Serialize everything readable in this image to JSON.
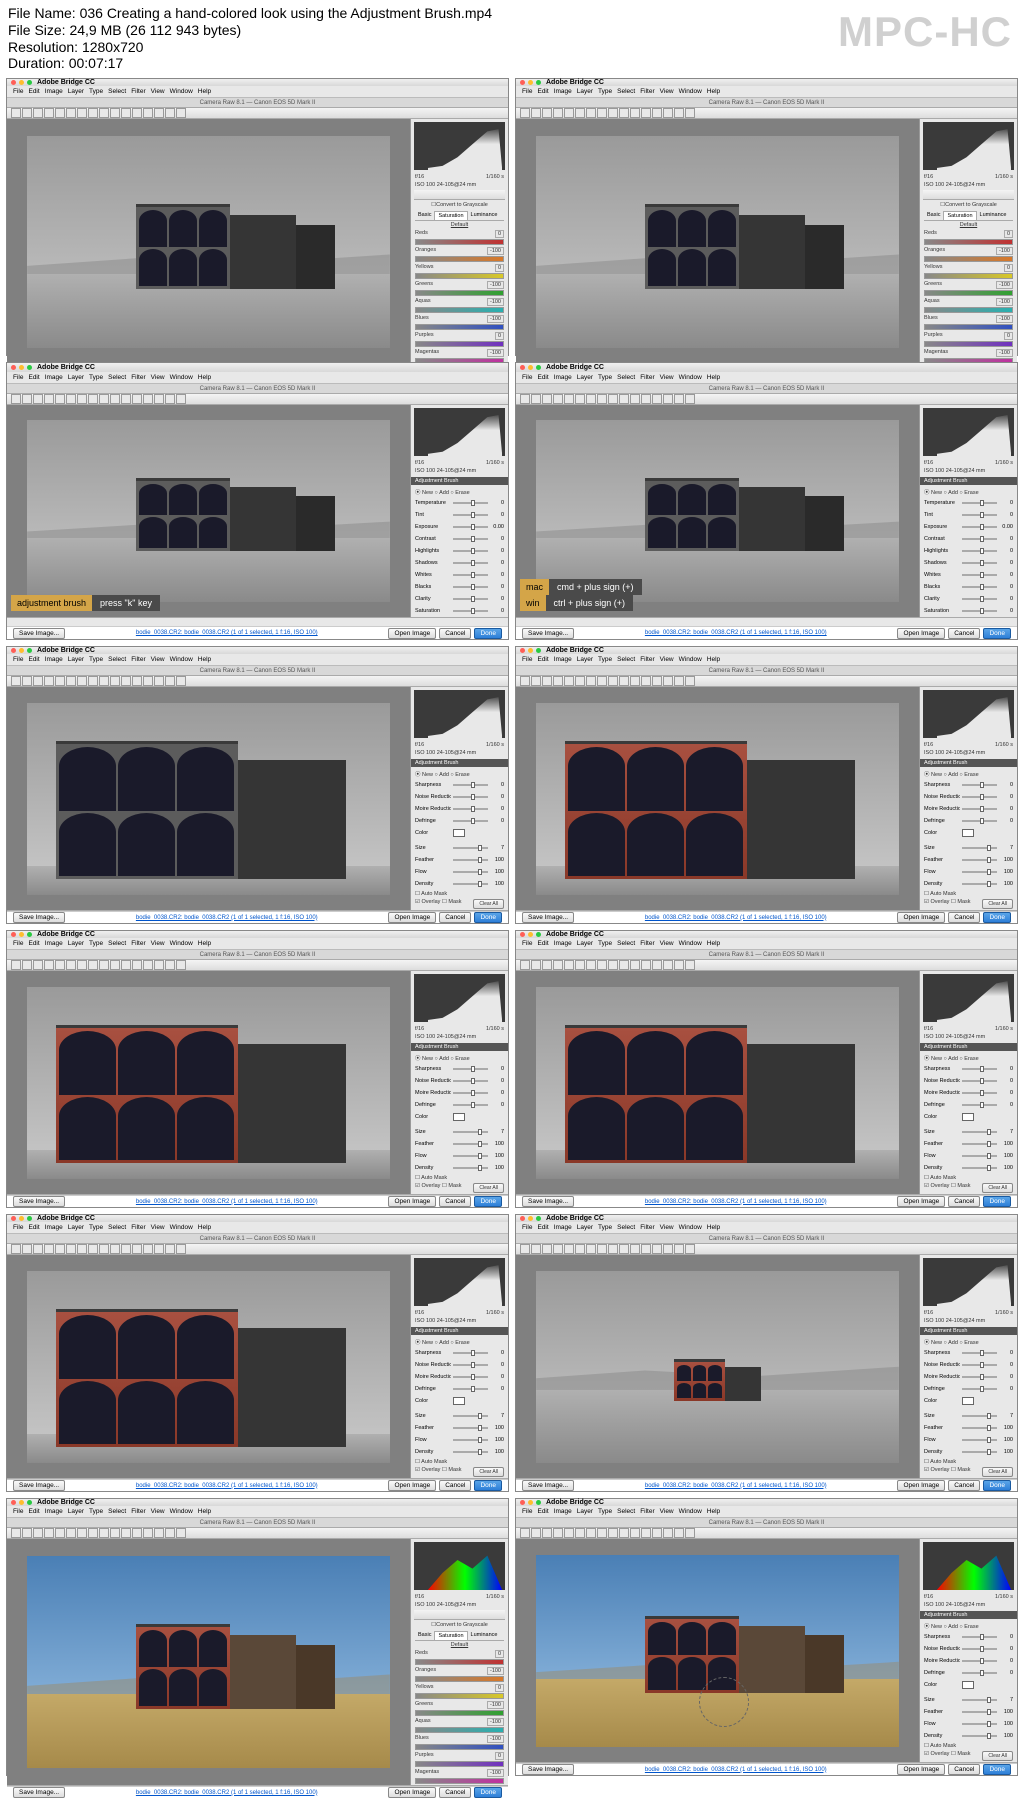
{
  "meta": {
    "l1_label": "File Name:",
    "l1": "036 Creating a hand-colored look using the Adjustment Brush.mp4",
    "l2_label": "File Size:",
    "l2": "24,9 MB (26 112 943 bytes)",
    "l3_label": "Resolution:",
    "l3": "1280x720",
    "l4_label": "Duration:",
    "l4": "00:07:17"
  },
  "watermark": "MPC-HC",
  "app_title": "Adobe Bridge CC",
  "menus": [
    "File",
    "Edit",
    "Image",
    "Layer",
    "Type",
    "Select",
    "Filter",
    "View",
    "Window",
    "Help"
  ],
  "sub_title": "Camera Raw 8.1 — Canon EOS 5D Mark II",
  "footer": {
    "save": "Save Image...",
    "link": "bodie_0038.CR2: bodie_0038.CR2 (1 of 1 selected, 1 f:16, ISO 100)",
    "open": "Open Image",
    "cancel": "Cancel",
    "done": "Done"
  },
  "hint1": {
    "k1": "adjustment brush",
    "v1": "press \"k\" key"
  },
  "hint2": {
    "m": "mac",
    "mv": "cmd + plus sign (+)",
    "w": "win",
    "wv": "ctrl + plus sign (+)"
  },
  "hsl_panel": {
    "tabs": [
      "Basic",
      "Saturation",
      "Luminance"
    ],
    "convert_bw": "Convert to Grayscale",
    "hdr": "Default",
    "items": [
      {
        "name": "Reds",
        "val": "0",
        "col": "#c03030"
      },
      {
        "name": "Oranges",
        "val": "-100",
        "col": "#d87828"
      },
      {
        "name": "Yellows",
        "val": "0",
        "col": "#d8c828"
      },
      {
        "name": "Greens",
        "val": "-100",
        "col": "#30a030"
      },
      {
        "name": "Aquas",
        "val": "-100",
        "col": "#28b0b0"
      },
      {
        "name": "Blues",
        "val": "-100",
        "col": "#3050c0"
      },
      {
        "name": "Purples",
        "val": "0",
        "col": "#7030c0"
      },
      {
        "name": "Magentas",
        "val": "-100",
        "col": "#c030a0"
      }
    ]
  },
  "brush_panel": {
    "hdr": "Adjustment Brush",
    "newedit": "⦿ New  ○ Add  ○ Erase",
    "sliders1": [
      {
        "name": "Temperature",
        "val": "0"
      },
      {
        "name": "Tint",
        "val": "0"
      },
      {
        "name": "Exposure",
        "val": "0.00"
      },
      {
        "name": "Contrast",
        "val": "0"
      },
      {
        "name": "Highlights",
        "val": "0"
      },
      {
        "name": "Shadows",
        "val": "0"
      },
      {
        "name": "Whites",
        "val": "0"
      },
      {
        "name": "Blacks",
        "val": "0"
      },
      {
        "name": "Clarity",
        "val": "0"
      },
      {
        "name": "Saturation",
        "val": "0"
      }
    ],
    "sliders2": [
      {
        "name": "Sharpness",
        "val": "0"
      },
      {
        "name": "Noise Reduction",
        "val": "0"
      },
      {
        "name": "Moire Reduction",
        "val": "0"
      },
      {
        "name": "Defringe",
        "val": "0"
      }
    ],
    "color_lbl": "Color",
    "sz": [
      {
        "name": "Size",
        "val": "7"
      },
      {
        "name": "Feather",
        "val": "100"
      },
      {
        "name": "Flow",
        "val": "100"
      },
      {
        "name": "Density",
        "val": "100"
      }
    ],
    "automask": "☐ Auto Mask",
    "overlay": "☑ Overlay  ☐ Mask",
    "clear": "Clear All"
  },
  "info": {
    "line1": "1/160 s",
    "line2": "ISO 100  24-105@24 mm"
  }
}
